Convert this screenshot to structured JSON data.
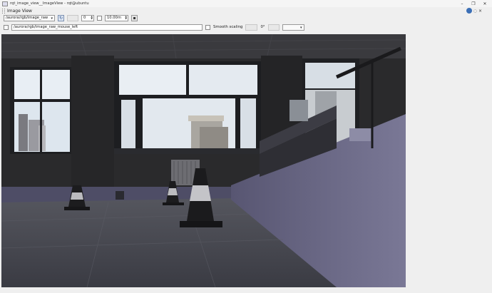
{
  "window": {
    "title": "rqt_image_view__ImageView - rqt@ubuntu",
    "minimize": "–",
    "maximize": "❐",
    "close": "✕"
  },
  "plugin": {
    "title": "Image View",
    "help_glyph": "⦿",
    "close_glyph": "◌",
    "x_glyph": "×"
  },
  "toolbar": {
    "topic": "/aurora/rgb/image_raw",
    "refresh_glyph": "↻",
    "spin_value": "0",
    "max_range": "10.00m",
    "mouse_topic": "/aurora/rgb/image_raw_mouse_left",
    "smooth_label": "Smooth scaling",
    "rotation": "0°",
    "rotate_left": "",
    "rotate_right": ""
  },
  "colors": {
    "wall": "#6b6a8a",
    "floor": "#4a4b55",
    "window_sky": "#e6ecf2",
    "cone": "#1a1a1a"
  }
}
